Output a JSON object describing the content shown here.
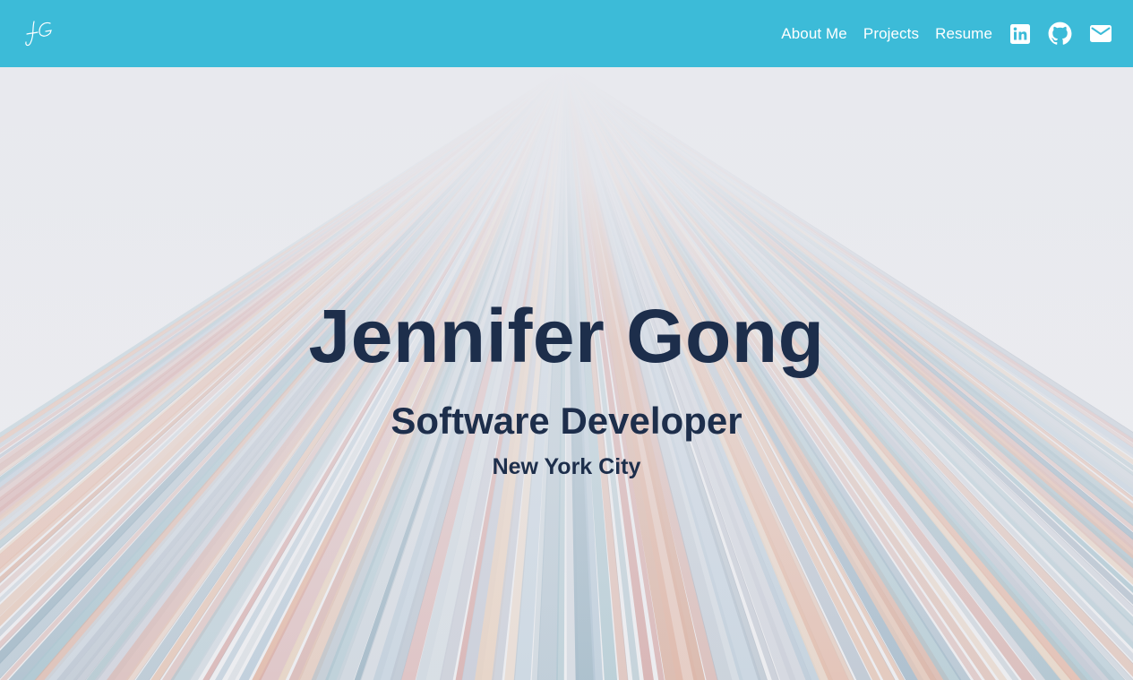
{
  "nav": {
    "logo_text": "JG",
    "links": [
      {
        "label": "About Me"
      },
      {
        "label": "Projects"
      },
      {
        "label": "Resume"
      }
    ],
    "icons": [
      "linkedin-icon",
      "github-icon",
      "mail-icon"
    ]
  },
  "hero": {
    "name": "Jennifer Gong",
    "title": "Software Developer",
    "location": "New York City"
  },
  "colors": {
    "navbar": "#3cbbd8",
    "nav_text": "#ffffff",
    "heading": "#1d2e4b",
    "background": "#e8e9ee"
  }
}
